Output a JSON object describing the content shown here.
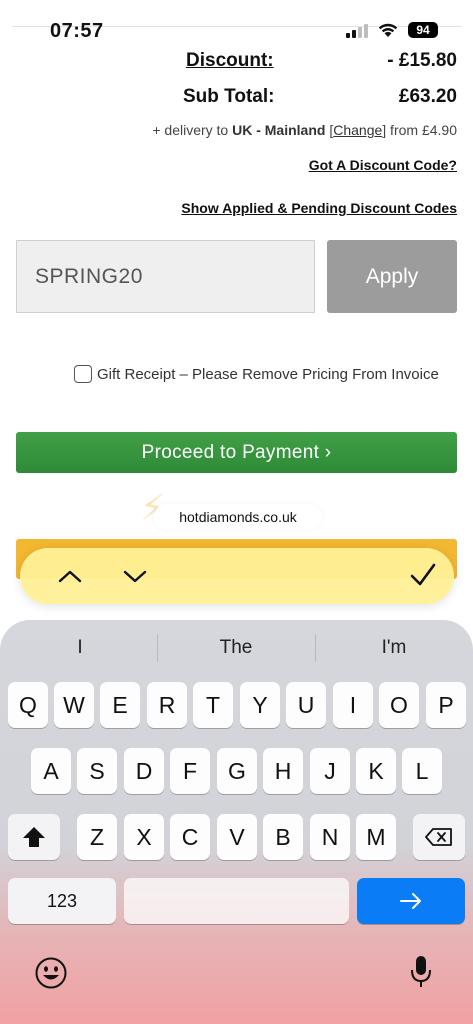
{
  "status_bar": {
    "time": "07:57",
    "battery": "94"
  },
  "summary": {
    "discount_label": "Discount:",
    "discount_value": "- £15.80",
    "subtotal_label": "Sub Total:",
    "subtotal_value": "£63.20",
    "delivery_prefix": "+ delivery to ",
    "delivery_region": "UK - Mainland",
    "delivery_bracket_open": " [",
    "delivery_change": "Change",
    "delivery_bracket_close": "]",
    "delivery_suffix": " from £4.90"
  },
  "links": {
    "discount_code": "Got A Discount Code?",
    "applied_codes": "Show Applied & Pending Discount Codes"
  },
  "discount_form": {
    "code_value": "SPRING20",
    "apply_label": "Apply"
  },
  "gift_receipt": {
    "label": "Gift Receipt – Please Remove Pricing From Invoice",
    "checked": false
  },
  "payment": {
    "label": "Proceed to Payment ›"
  },
  "browser": {
    "url": "hotdiamonds.co.uk"
  },
  "find_bar": {
    "up_icon": "chevron-up-icon",
    "down_icon": "chevron-down-icon",
    "done_icon": "checkmark-icon"
  },
  "keyboard": {
    "suggestions": [
      "I",
      "The",
      "I'm"
    ],
    "row1": [
      "Q",
      "W",
      "E",
      "R",
      "T",
      "Y",
      "U",
      "I",
      "O",
      "P"
    ],
    "row2": [
      "A",
      "S",
      "D",
      "F",
      "G",
      "H",
      "J",
      "K",
      "L"
    ],
    "row3": [
      "Z",
      "X",
      "C",
      "V",
      "B",
      "N",
      "M"
    ],
    "numbers_label": "123",
    "shift_icon": "shift-icon",
    "delete_icon": "backspace-icon",
    "return_icon": "arrow-right-icon",
    "emoji_icon": "emoji-icon",
    "mic_icon": "microphone-icon",
    "return_color": "#0a7cf5"
  },
  "colors": {
    "payment_green": "#3a9a41",
    "apply_gray": "#9c9c9c",
    "find_yellow": "#fff096"
  }
}
